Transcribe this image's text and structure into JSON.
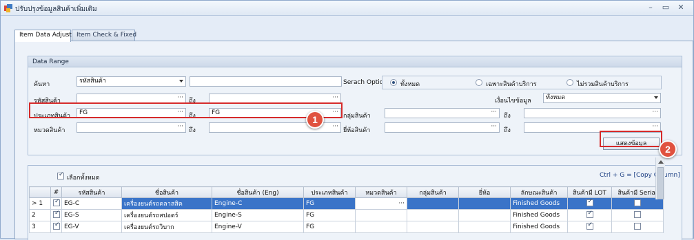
{
  "window": {
    "title": "ปรับปรุงข้อมูลสินค้าเพิ่มเติม",
    "minimize": "–",
    "restore": "▭",
    "close": "✕"
  },
  "tabs": [
    {
      "label": "Item Data Adjust"
    },
    {
      "label": "Item Check & Fixed"
    }
  ],
  "data_range": {
    "title": "Data Range",
    "search_label": "ค้นหา",
    "search_by_value": "รหัสสินค้า",
    "search_text": "",
    "search_option_label": "Serach Option",
    "options": [
      {
        "label": "ทั้งหมด"
      },
      {
        "label": "เฉพาะสินค้าบริการ"
      },
      {
        "label": "ไม่รวมสินค้าบริการ"
      }
    ],
    "condition_label": "เงื่อนไขข้อมูล",
    "condition_value": "ทั้งหมด",
    "to_label": "ถึง",
    "ellipsis": "···",
    "rows": [
      {
        "label": "รหัสสินค้า",
        "from": "",
        "to": ""
      },
      {
        "label": "ประเภทสินค้า",
        "from": "FG",
        "to": "FG"
      },
      {
        "label": "หมวดสินค้า",
        "from": "",
        "to": ""
      }
    ],
    "right_rows": [
      {
        "label": "กลุ่มสินค้า",
        "from": "",
        "to": ""
      },
      {
        "label": "ยี่ห้อสินค้า",
        "from": "",
        "to": ""
      }
    ],
    "show_button": "แสดงข้อมูล"
  },
  "badges": [
    "1",
    "2"
  ],
  "grid": {
    "select_all_label": "เลือกทั้งหมด",
    "copy_hint": "Ctrl + G = [Copy Column]",
    "headers": [
      "",
      "#",
      "รหัสสินค้า",
      "ชื่อสินค้า",
      "ชื่อสินค้า (Eng)",
      "ประเภทสินค้า",
      "หมวดสินค้า",
      "กลุ่มสินค้า",
      "ยี่ห้อ",
      "ลักษณะสินค้า",
      "สินค้ามี LOT",
      "สินค้ามี Serial"
    ],
    "rows": [
      {
        "row": "> 1",
        "code": "EG-C",
        "name": "เครื่องยนต์รถคลาสสิค",
        "name_en": "Engine-C",
        "type": "FG",
        "category": "···",
        "group": "",
        "brand": "",
        "nature": "Finished Goods",
        "lot": true,
        "serial": false
      },
      {
        "row": "2",
        "code": "EG-S",
        "name": "เครื่องยนต์รถสปอตร์",
        "name_en": "Engine-S",
        "type": "FG",
        "category": "",
        "group": "",
        "brand": "",
        "nature": "Finished Goods",
        "lot": true,
        "serial": false
      },
      {
        "row": "3",
        "code": "EG-V",
        "name": "เครื่องยนต์รถวิบาก",
        "name_en": "Engine-V",
        "type": "FG",
        "category": "",
        "group": "",
        "brand": "",
        "nature": "Finished Goods",
        "lot": true,
        "serial": false
      }
    ]
  }
}
